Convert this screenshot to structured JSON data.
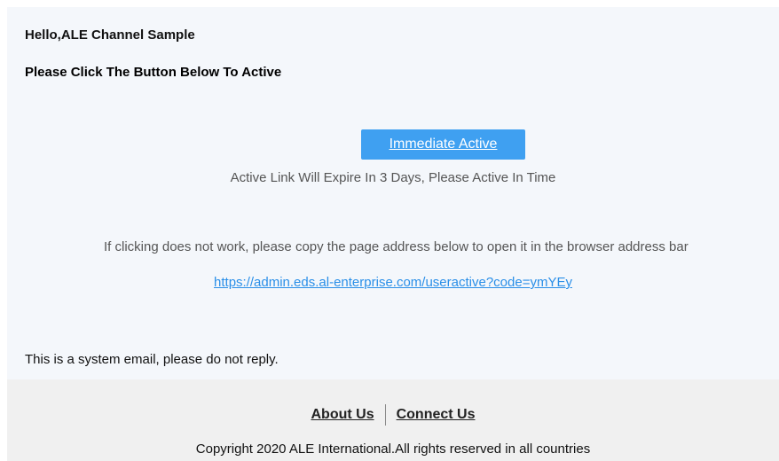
{
  "email": {
    "greeting": "Hello,ALE Channel Sample",
    "instruction": "Please Click The Button Below To Active",
    "button_label": "Immediate Active",
    "expire_note": "Active Link Will Expire In 3 Days, Please Active In Time",
    "fallback_note": "If clicking does not work, please copy the page address below to open it in the browser address bar",
    "activation_link": "https://admin.eds.al-enterprise.com/useractive?code=ymYEy",
    "system_note": "This is a system email, please do not reply."
  },
  "footer": {
    "about_label": "About Us",
    "connect_label": "Connect Us",
    "copyright": "Copyright 2020 ALE International.All rights reserved in all countries"
  },
  "colors": {
    "button": "#3fa0f1",
    "link": "#2a8fe8",
    "page_background": "#f4f7fb",
    "footer_background": "#f0f0f0"
  }
}
